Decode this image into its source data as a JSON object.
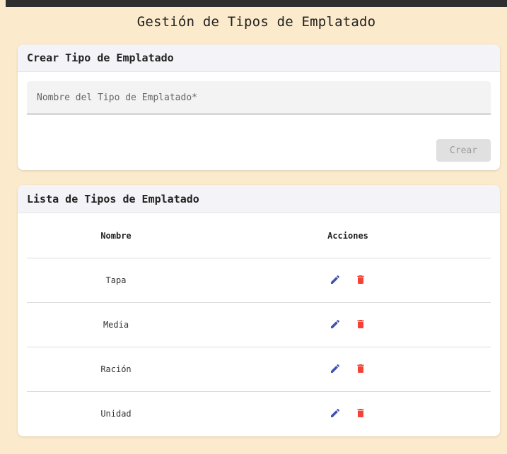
{
  "page_title": "Gestión de Tipos de Emplatado",
  "create_card": {
    "title": "Crear Tipo de Emplatado",
    "name_field": {
      "placeholder": "Nombre del Tipo de Emplatado*",
      "value": ""
    },
    "create_label": "Crear"
  },
  "list_card": {
    "title": "Lista de Tipos de Emplatado",
    "columns": [
      "Nombre",
      "Acciones"
    ],
    "rows": [
      {
        "name": "Tapa"
      },
      {
        "name": "Media"
      },
      {
        "name": "Ración"
      },
      {
        "name": "Unidad"
      }
    ]
  },
  "colors": {
    "background": "#fbeacc",
    "edit_icon": "#3f51b5",
    "delete_icon": "#f44336",
    "disabled_button": "#e0e0e0"
  },
  "icons": {
    "edit": "pencil-icon",
    "delete": "trash-icon"
  }
}
